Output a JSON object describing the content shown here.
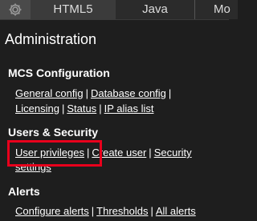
{
  "tabs": [
    {
      "label": "HTML5"
    },
    {
      "label": "Java"
    },
    {
      "label": "Mo"
    }
  ],
  "gear_icon": "gear-icon",
  "page_title": "Administration",
  "sections": {
    "mcs": {
      "heading": "MCS Configuration",
      "links": [
        "General config",
        "Database config",
        "Licensing",
        "Status",
        "IP alias list"
      ]
    },
    "users": {
      "heading": "Users & Security",
      "links": [
        "User privileges",
        "Create user",
        "Security",
        "settings"
      ]
    },
    "alerts": {
      "heading": "Alerts",
      "links": [
        "Configure alerts",
        "Thresholds",
        "All alerts"
      ]
    }
  },
  "separator": "|",
  "colors": {
    "background": "#1e1e1e",
    "highlight": "#e8001c",
    "text": "#ffffff"
  }
}
